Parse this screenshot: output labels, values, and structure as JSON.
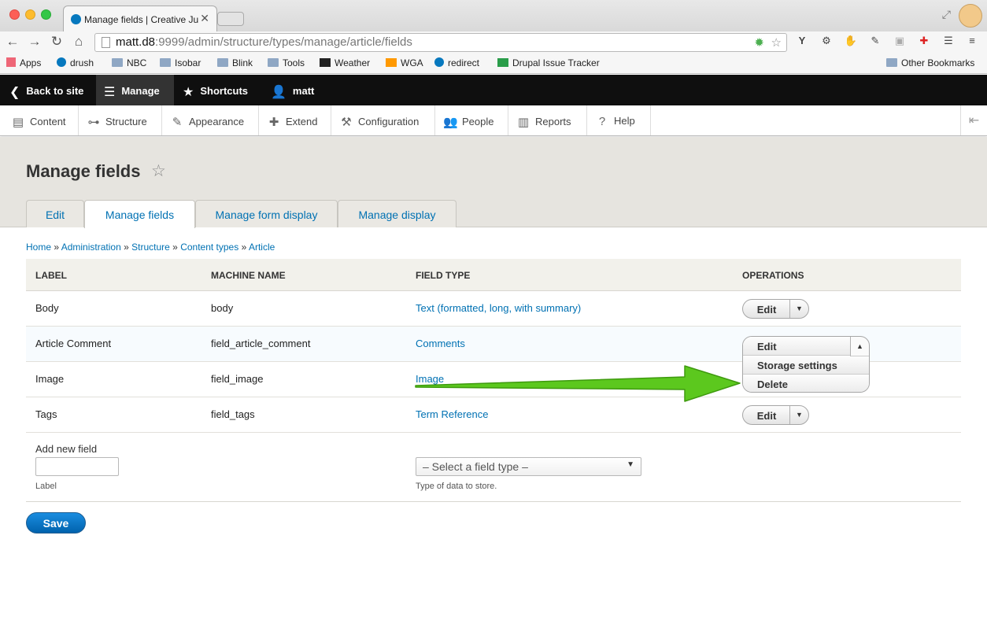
{
  "browser": {
    "tab_title": "Manage fields | Creative Ju",
    "url_host": "matt.d8",
    "url_rest": ":9999/admin/structure/types/manage/article/fields",
    "bookmarks": [
      "Apps",
      "drush",
      "NBC",
      "Isobar",
      "Blink",
      "Tools",
      "Weather",
      "WGA",
      "redirect",
      "Drupal Issue Tracker"
    ],
    "other_bookmarks": "Other Bookmarks"
  },
  "admin_bar": {
    "back": "Back to site",
    "manage": "Manage",
    "shortcuts": "Shortcuts",
    "user": "matt"
  },
  "admin_menu": [
    "Content",
    "Structure",
    "Appearance",
    "Extend",
    "Configuration",
    "People",
    "Reports",
    "Help"
  ],
  "page": {
    "title": "Manage fields",
    "tabs": [
      "Edit",
      "Manage fields",
      "Manage form display",
      "Manage display"
    ],
    "active_tab": "Manage fields"
  },
  "breadcrumb": [
    "Home",
    "Administration",
    "Structure",
    "Content types",
    "Article"
  ],
  "breadcrumb_sep": "»",
  "table": {
    "headers": [
      "Label",
      "Machine name",
      "Field type",
      "Operations"
    ],
    "rows": [
      {
        "label": "Body",
        "machine": "body",
        "type": "Text (formatted, long, with summary)",
        "op": "Edit"
      },
      {
        "label": "Article Comment",
        "machine": "field_article_comment",
        "type": "Comments",
        "op": "Edit"
      },
      {
        "label": "Image",
        "machine": "field_image",
        "type": "Image",
        "op": "Edit"
      },
      {
        "label": "Tags",
        "machine": "field_tags",
        "type": "Term Reference",
        "op": "Edit"
      }
    ],
    "open_dropdown": [
      "Edit",
      "Storage settings",
      "Delete"
    ]
  },
  "add_field": {
    "heading": "Add new field",
    "label_desc": "Label",
    "select_value": "– Select a field type –",
    "select_desc": "Type of data to store."
  },
  "save_label": "Save",
  "colors": {
    "link": "#0071b3",
    "arrow": "#5cc81e",
    "save": "#0074bd"
  }
}
